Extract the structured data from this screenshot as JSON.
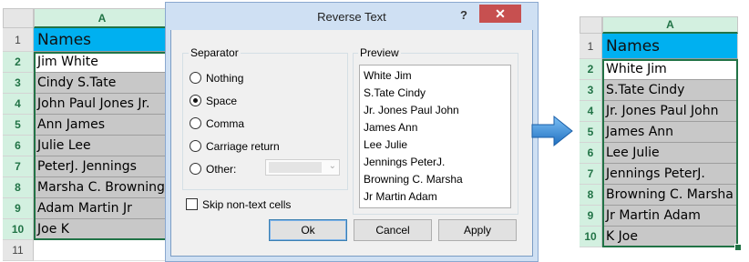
{
  "left_sheet": {
    "column_letter": "A",
    "row_numbers": [
      "1",
      "2",
      "3",
      "4",
      "5",
      "6",
      "7",
      "8",
      "9",
      "10",
      "11"
    ],
    "header_cell": "Names",
    "cells": [
      "Jim White",
      "Cindy S.Tate",
      "John Paul Jones Jr.",
      "Ann James",
      "Julie Lee",
      "PeterJ. Jennings",
      "Marsha C. Browning",
      "Adam Martin Jr",
      "Joe K"
    ]
  },
  "dialog": {
    "title": "Reverse Text",
    "help": "?",
    "close": "✕",
    "separator_label": "Separator",
    "options": [
      "Nothing",
      "Space",
      "Comma",
      "Carriage return",
      "Other:"
    ],
    "selected_option": "Space",
    "preview_label": "Preview",
    "preview_items": [
      "White Jim",
      "S.Tate Cindy",
      "Jr. Jones Paul John",
      "James Ann",
      "Lee Julie",
      "Jennings PeterJ.",
      "Browning C. Marsha",
      "Jr Martin Adam"
    ],
    "skip_label": "Skip non-text cells",
    "buttons": {
      "ok": "Ok",
      "cancel": "Cancel",
      "apply": "Apply"
    }
  },
  "right_sheet": {
    "column_letter": "A",
    "row_numbers": [
      "1",
      "2",
      "3",
      "4",
      "5",
      "6",
      "7",
      "8",
      "9",
      "10"
    ],
    "header_cell": "Names",
    "cells": [
      "White Jim",
      "S.Tate Cindy",
      "Jr. Jones Paul John",
      "James Ann",
      "Lee Julie",
      "Jennings PeterJ.",
      "Browning C. Marsha",
      "Jr Martin Adam",
      "K Joe"
    ]
  },
  "colors": {
    "header_fill": "#00b0f0",
    "selection": "#217346",
    "arrow": "#2e86d6",
    "close_button": "#c75050"
  }
}
